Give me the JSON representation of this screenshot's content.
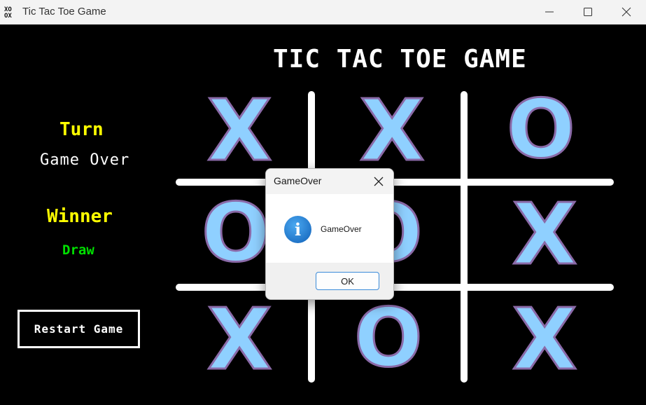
{
  "window": {
    "title": "Tic Tac Toe Game",
    "icon_text": "XO\nOX"
  },
  "game": {
    "title": "TIC TAC TOE GAME",
    "turn_label": "Turn",
    "turn_value": "Game Over",
    "winner_label": "Winner",
    "winner_value": "Draw",
    "restart_label": "Restart Game",
    "board": [
      [
        "X",
        "X",
        "O"
      ],
      [
        "O",
        "O",
        "X"
      ],
      [
        "X",
        "O",
        "X"
      ]
    ]
  },
  "dialog": {
    "title": "GameOver",
    "message": "GameOver",
    "ok_label": "OK",
    "icon": "info-icon"
  },
  "colors": {
    "label_yellow": "#ffff00",
    "draw_green": "#00e000",
    "mark_fill": "#8fd0ff",
    "mark_outline": "#8a6aa8",
    "accent_blue": "#3b8bd9"
  }
}
